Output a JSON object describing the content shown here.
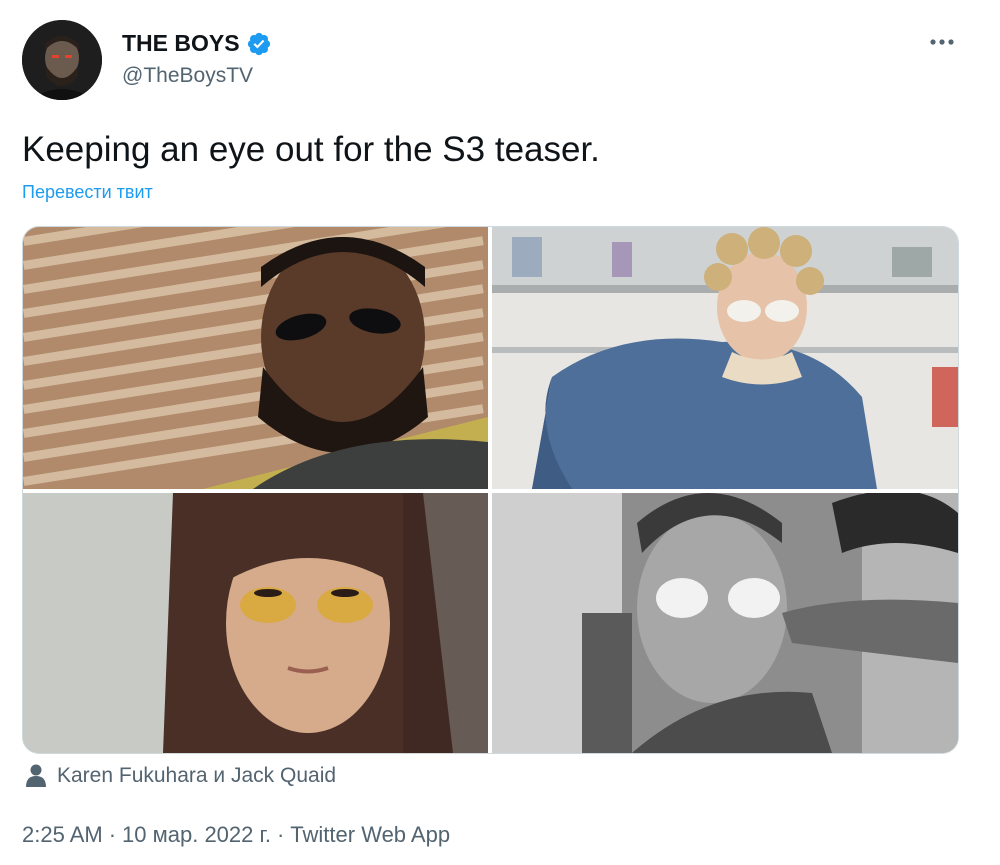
{
  "tweet": {
    "author_name": "THE BOYS",
    "author_handle": "@TheBoysTV",
    "text": "Keeping an eye out for the S3 teaser.",
    "translate_label": "Перевести твит",
    "tagged_people": "Karen Fukuhara и Jack Quaid",
    "time": "2:25 AM",
    "date": "10 мар. 2022 г.",
    "source": "Twitter Web App",
    "separator": "·"
  },
  "icons": {
    "verified": "verified-badge-icon",
    "more": "more-options-icon",
    "tagged": "person-icon"
  },
  "colors": {
    "link": "#1d9bf0",
    "secondary_text": "#536471",
    "primary_text": "#0f1419",
    "border": "#cfd9de"
  }
}
